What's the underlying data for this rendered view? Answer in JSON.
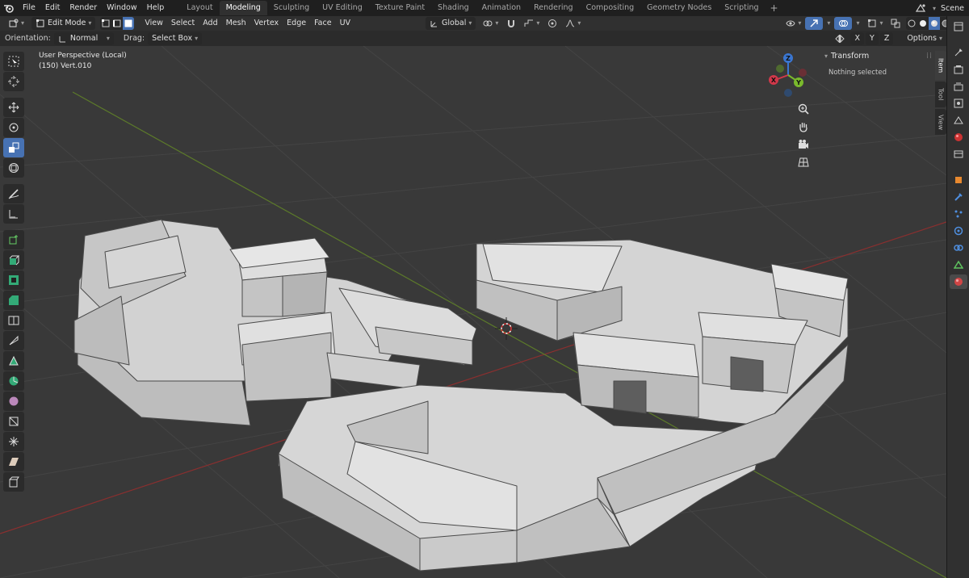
{
  "menu": [
    "File",
    "Edit",
    "Render",
    "Window",
    "Help"
  ],
  "workspaces": [
    {
      "label": "Layout",
      "active": false
    },
    {
      "label": "Modeling",
      "active": true
    },
    {
      "label": "Sculpting",
      "active": false
    },
    {
      "label": "UV Editing",
      "active": false
    },
    {
      "label": "Texture Paint",
      "active": false
    },
    {
      "label": "Shading",
      "active": false
    },
    {
      "label": "Animation",
      "active": false
    },
    {
      "label": "Rendering",
      "active": false
    },
    {
      "label": "Compositing",
      "active": false
    },
    {
      "label": "Geometry Nodes",
      "active": false
    },
    {
      "label": "Scripting",
      "active": false
    }
  ],
  "workspace_add": "+",
  "scene": {
    "name": "Scene"
  },
  "header": {
    "mode": "Edit Mode",
    "menus": [
      "View",
      "Select",
      "Add",
      "Mesh",
      "Vertex",
      "Edge",
      "Face",
      "UV"
    ],
    "transform_orientation": "Global"
  },
  "toolsettings": {
    "orientation_label": "Orientation:",
    "orientation_value": "Normal",
    "drag_label": "Drag:",
    "drag_value": "Select Box",
    "axes": [
      "X",
      "Y",
      "Z"
    ],
    "options_label": "Options"
  },
  "viewport": {
    "perspective": "User Perspective (Local)",
    "object_info": "(150) Vert.010"
  },
  "gizmo": {
    "x": "X",
    "y": "Y",
    "z": "Z"
  },
  "npanel": {
    "panel_title": "Transform",
    "message": "Nothing selected",
    "tabs": [
      {
        "label": "Item",
        "active": true
      },
      {
        "label": "Tool",
        "active": false
      },
      {
        "label": "View",
        "active": false
      }
    ]
  },
  "colors": {
    "accent": "#4772b3",
    "viewport_bg": "#393939",
    "mesh": "#d9d9d9"
  }
}
